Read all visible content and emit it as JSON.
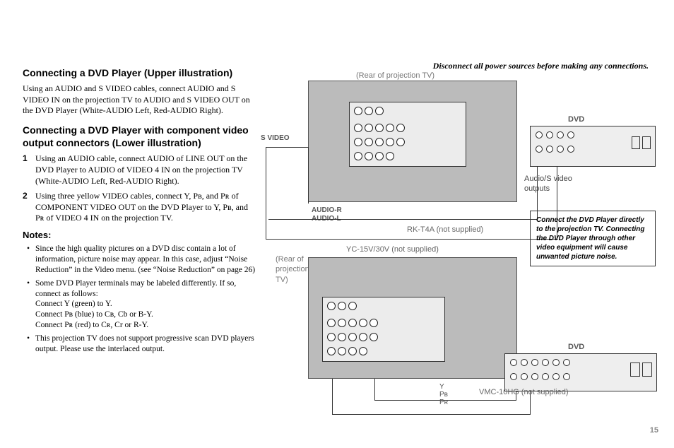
{
  "banner": "Disconnect all power sources before making any connections.",
  "left": {
    "heading1": "Connecting a DVD Player (Upper illustration)",
    "para1": "Using an AUDIO and S VIDEO cables, connect AUDIO and S VIDEO IN on the projection TV to AUDIO and S VIDEO OUT on the DVD Player (White-AUDIO Left, Red-AUDIO Right).",
    "heading2": "Connecting a DVD Player with component video output connectors (Lower illustration)",
    "step1": "Using an AUDIO cable, connect AUDIO of LINE OUT on the DVD Player to AUDIO of VIDEO 4 IN on the projection TV (White-AUDIO Left, Red-AUDIO Right).",
    "step2": "Using three yellow VIDEO cables, connect Y, Pʙ, and Pʀ of COMPONENT VIDEO OUT on the DVD Player to Y, Pʙ, and Pʀ of VIDEO 4 IN on the projection TV.",
    "notes_h": "Notes:",
    "note1": "Since the high quality pictures on a DVD disc contain a lot of information, picture noise may appear. In this case, adjust “Noise Reduction” in the Video menu. (see “Noise Reduction” on page 26)",
    "note2": "Some DVD Player terminals may be labeled differently. If so, connect as follows:",
    "note2a": "Connect Y (green) to Y.",
    "note2b": "Connect Pʙ (blue) to Cʙ, Cb or B-Y.",
    "note2c": "Connect Pʀ (red) to Cʀ, Cr or R-Y.",
    "note3": "This projection TV does not support progressive scan DVD players output. Please use the interlaced output."
  },
  "diag": {
    "rear1": "(Rear of projection TV)",
    "svideo": "S VIDEO",
    "audior": "AUDIO-R",
    "audiol": "AUDIO-L",
    "dvd": "DVD",
    "audio_out": "Audio/S video outputs",
    "rkt4a": "RK-T4A (not supplied)",
    "yc1530": "YC-15V/30V (not supplied)",
    "notebox": "Connect the DVD Player directly to the projection TV. Connecting the DVD Player through other video equipment will cause unwanted picture noise.",
    "rear2": "(Rear of projection TV)",
    "ypbpr_y": "Y",
    "ypbpr_pb": "Pʙ",
    "ypbpr_pr": "Pʀ",
    "vmc": "VMC-10HG (not supplied)"
  },
  "page": "15"
}
